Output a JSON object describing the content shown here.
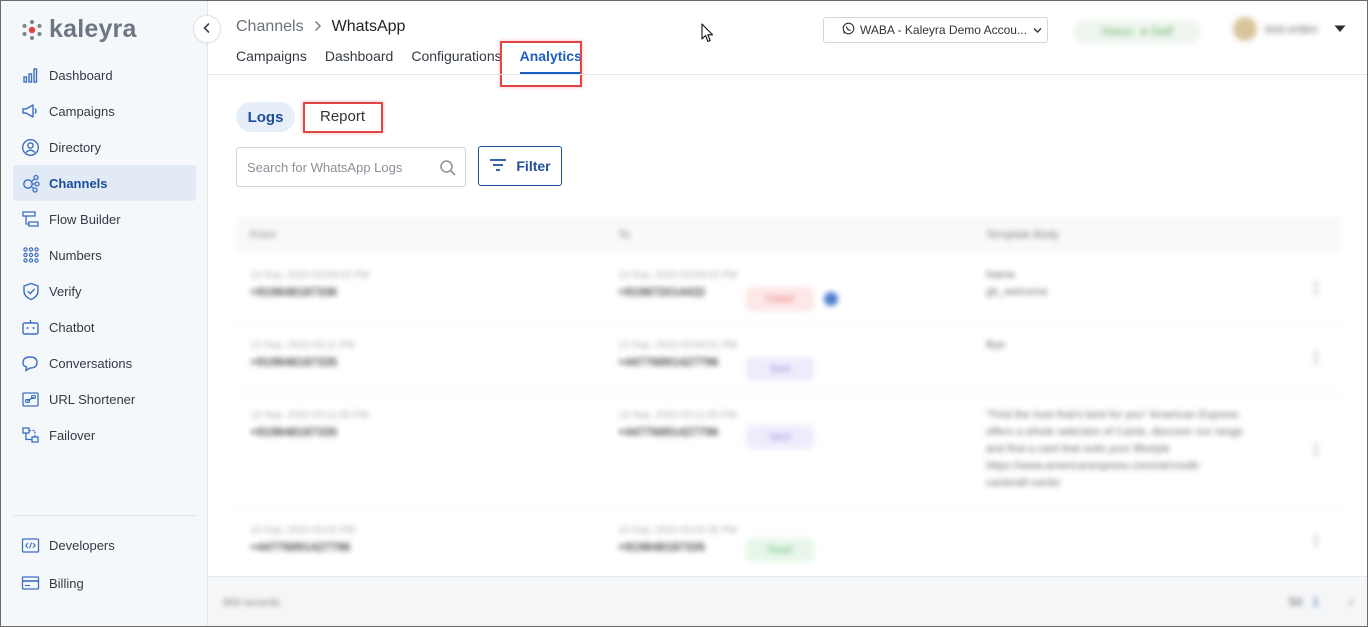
{
  "brand": {
    "name": "kaleyra"
  },
  "sidebar": {
    "items": [
      {
        "label": "Dashboard",
        "icon": "bar-chart-icon"
      },
      {
        "label": "Campaigns",
        "icon": "megaphone-icon"
      },
      {
        "label": "Directory",
        "icon": "contact-icon"
      },
      {
        "label": "Channels",
        "icon": "channels-icon",
        "active": true
      },
      {
        "label": "Flow Builder",
        "icon": "flow-icon"
      },
      {
        "label": "Numbers",
        "icon": "dialpad-icon"
      },
      {
        "label": "Verify",
        "icon": "shield-check-icon"
      },
      {
        "label": "Chatbot",
        "icon": "chatbot-icon"
      },
      {
        "label": "Conversations",
        "icon": "chat-bubbles-icon"
      },
      {
        "label": "URL Shortener",
        "icon": "link-icon"
      },
      {
        "label": "Failover",
        "icon": "failover-icon"
      }
    ],
    "bottom_items": [
      {
        "label": "Developers",
        "icon": "code-icon"
      },
      {
        "label": "Billing",
        "icon": "credit-card-icon"
      }
    ]
  },
  "breadcrumb": {
    "parent": "Channels",
    "current": "WhatsApp"
  },
  "tabs": [
    {
      "label": "Campaigns"
    },
    {
      "label": "Dashboard"
    },
    {
      "label": "Configurations"
    },
    {
      "label": "Analytics",
      "active": true
    }
  ],
  "account_selector": {
    "label": "WABA - Kaleyra Demo Accou..."
  },
  "status_pill": {
    "label": "Status",
    "value": "● Staff"
  },
  "user": {
    "name": "test.ordev"
  },
  "subtabs": {
    "logs": "Logs",
    "report": "Report"
  },
  "search": {
    "placeholder": "Search for WhatsApp Logs"
  },
  "filter": {
    "label": "Filter"
  },
  "table": {
    "headers": {
      "from": "From",
      "to": "To",
      "body": "Template Body"
    },
    "rows": [
      {
        "from_time": "13 Sep, 2023 03:09:02 PM",
        "from_num": "+919848187336",
        "to_time": "13 Sep, 2023 03:09:02 PM",
        "to_num": "+919872014432",
        "status": "Failed",
        "body": [
          "Name",
          "gb_welcome"
        ]
      },
      {
        "from_time": "13 Sep, 2023 03:11 PM",
        "from_num": "+919848187335",
        "to_time": "13 Sep, 2023 03:06:51 PM",
        "to_num": "+44776891427796",
        "status": "Sent",
        "body": [
          "Bye"
        ]
      },
      {
        "from_time": "13 Sep, 2023 03:11:05 PM",
        "from_num": "+919848187335",
        "to_time": "13 Sep, 2023 03:11:05 PM",
        "to_num": "+44776891427796",
        "status": "Sent",
        "body": [
          "\"Find the rivet that's best for you\" American Express",
          "offers a whole selection of Cards, discover our range",
          "and find a card that suits your lifestyle",
          "https://www.americanexpress.com/uk/credit-",
          "cards/all-cards/"
        ]
      },
      {
        "from_time": "13 Sep, 2023 03:02 PM",
        "from_num": "+44776891427796",
        "to_time": "13 Sep, 2023 03:02:35 PM",
        "to_num": "+919848187335",
        "status": "Read",
        "body": []
      }
    ]
  },
  "footer": {
    "records": "369 records",
    "page_size": "50",
    "page": "1"
  }
}
